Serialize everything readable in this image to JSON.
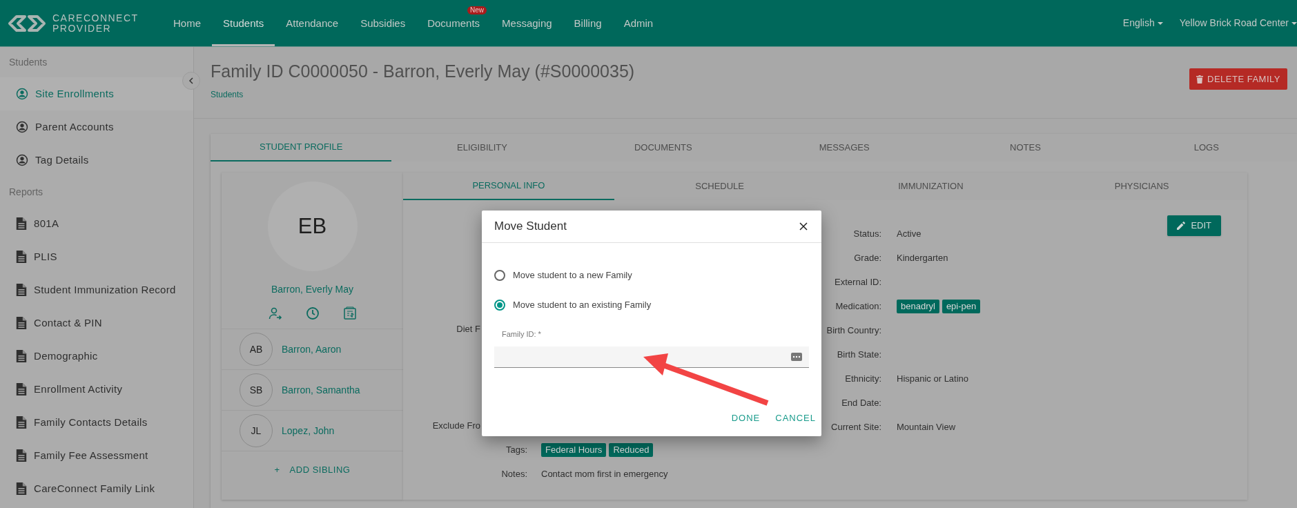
{
  "brand": {
    "line1": "CARECONNECT",
    "line2": "PROVIDER"
  },
  "nav": [
    {
      "label": "Home",
      "selected": false
    },
    {
      "label": "Students",
      "selected": true
    },
    {
      "label": "Attendance",
      "selected": false
    },
    {
      "label": "Subsidies",
      "selected": false
    },
    {
      "label": "Documents",
      "selected": false,
      "badge": "New"
    },
    {
      "label": "Messaging",
      "selected": false
    },
    {
      "label": "Billing",
      "selected": false
    },
    {
      "label": "Admin",
      "selected": false
    }
  ],
  "language": "English",
  "site": "Yellow Brick Road Center",
  "sidebar": [
    {
      "title": "Students",
      "items": [
        {
          "label": "Site Enrollments",
          "kind": "person",
          "selected": true
        },
        {
          "label": "Parent Accounts",
          "kind": "person",
          "selected": false
        },
        {
          "label": "Tag Details",
          "kind": "person",
          "selected": false
        }
      ]
    },
    {
      "title": "Reports",
      "items": [
        {
          "label": "801A",
          "kind": "doc",
          "selected": false
        },
        {
          "label": "PLIS",
          "kind": "doc",
          "selected": false
        },
        {
          "label": "Student Immunization Record",
          "kind": "doc",
          "selected": false
        },
        {
          "label": "Contact & PIN",
          "kind": "doc",
          "selected": false
        },
        {
          "label": "Demographic",
          "kind": "doc",
          "selected": false
        },
        {
          "label": "Enrollment Activity",
          "kind": "doc",
          "selected": false
        },
        {
          "label": "Family Contacts Details",
          "kind": "doc",
          "selected": false
        },
        {
          "label": "Family Fee Assessment",
          "kind": "doc",
          "selected": false
        },
        {
          "label": "CareConnect Family Link",
          "kind": "doc",
          "selected": false
        }
      ]
    }
  ],
  "page": {
    "title": "Family ID C0000050 - Barron, Everly May (#S0000035)",
    "breadcrumb": "Students",
    "delete_button": "DELETE FAMILY"
  },
  "tabs": [
    {
      "label": "STUDENT PROFILE",
      "selected": true
    },
    {
      "label": "ELIGIBILITY",
      "selected": false
    },
    {
      "label": "DOCUMENTS",
      "selected": false
    },
    {
      "label": "MESSAGES",
      "selected": false
    },
    {
      "label": "NOTES",
      "selected": false
    },
    {
      "label": "LOGS",
      "selected": false
    }
  ],
  "subtabs": [
    {
      "label": "PERSONAL INFO",
      "selected": true
    },
    {
      "label": "SCHEDULE",
      "selected": false
    },
    {
      "label": "IMMUNIZATION",
      "selected": false
    },
    {
      "label": "PHYSICIANS",
      "selected": false
    }
  ],
  "profile": {
    "initials": "EB",
    "name": "Barron, Everly May",
    "siblings": [
      {
        "initials": "AB",
        "name": "Barron, Aaron"
      },
      {
        "initials": "SB",
        "name": "Barron, Samantha"
      },
      {
        "initials": "JL",
        "name": "Lopez, John"
      }
    ],
    "add_icon": "+",
    "add_sibling": "ADD SIBLING"
  },
  "details": {
    "left": [
      {
        "label": "Diet F"
      },
      {
        "label": "Exclude Fro"
      },
      {
        "label": "Tags:",
        "tags": [
          "Federal Hours",
          "Reduced"
        ]
      },
      {
        "label": "Notes:",
        "value": "Contact mom first in emergency"
      }
    ],
    "right": [
      {
        "label": "Status:",
        "value": "Active"
      },
      {
        "label": "Grade:",
        "value": "Kindergarten"
      },
      {
        "label": "External ID:"
      },
      {
        "label": "Medication:",
        "tags": [
          "benadryl",
          "epi-pen"
        ]
      },
      {
        "label": "Birth Country:"
      },
      {
        "label": "Birth State:"
      },
      {
        "label": "Ethnicity:",
        "value": "Hispanic or Latino"
      },
      {
        "label": "End Date:"
      },
      {
        "label": "Current Site:",
        "value": "Mountain View"
      }
    ],
    "edit_button": "EDIT"
  },
  "modal": {
    "title": "Move Student",
    "options": [
      {
        "label": "Move student to a new Family",
        "selected": false
      },
      {
        "label": "Move student to an existing Family",
        "selected": true
      }
    ],
    "field": {
      "label": "Family ID: *"
    },
    "buttons": [
      "DONE",
      "CANCEL"
    ]
  }
}
